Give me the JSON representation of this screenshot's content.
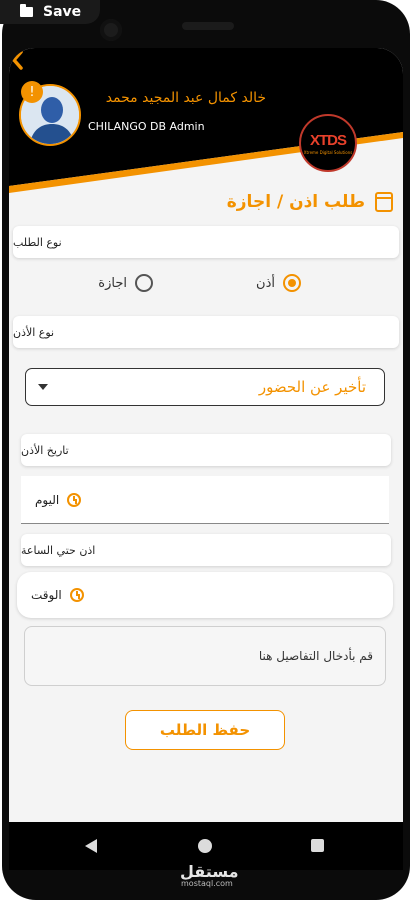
{
  "top_chip": {
    "label": "Save",
    "icon": "folder-icon"
  },
  "header": {
    "user_name": "خالد كمال عبد المجيد  محمد",
    "user_role": "CHILANGO DB Admin",
    "back_icon": "chevron-left-icon",
    "bell_icon": "bell-icon",
    "logo_text": "XTDS",
    "logo_sub": "Xtreme Digital Solutions"
  },
  "page": {
    "title": "طلب اذن / اجازة",
    "title_icon": "calendar-icon"
  },
  "request_type": {
    "label": "نوع الطلب",
    "options": [
      {
        "label": "أذن",
        "selected": true
      },
      {
        "label": "اجازة",
        "selected": false
      }
    ]
  },
  "permission_type": {
    "label": "نوع الأذن",
    "selected": "تأخير عن الحضور"
  },
  "permission_date": {
    "label": "تاريخ الأذن",
    "value": "اليوم",
    "icon": "clock-icon"
  },
  "until_time": {
    "label": "اذن حتي الساعة",
    "value": "الوقت",
    "icon": "alarm-icon"
  },
  "details": {
    "placeholder": "قم بأدخال التفاصيل هنا"
  },
  "save_button": {
    "label": "حفظ الطلب"
  },
  "watermark": {
    "main": "مستقل",
    "sub": "mostaql.com"
  },
  "colors": {
    "accent": "#f39200",
    "dark": "#000000",
    "background": "#f4f4f4"
  }
}
